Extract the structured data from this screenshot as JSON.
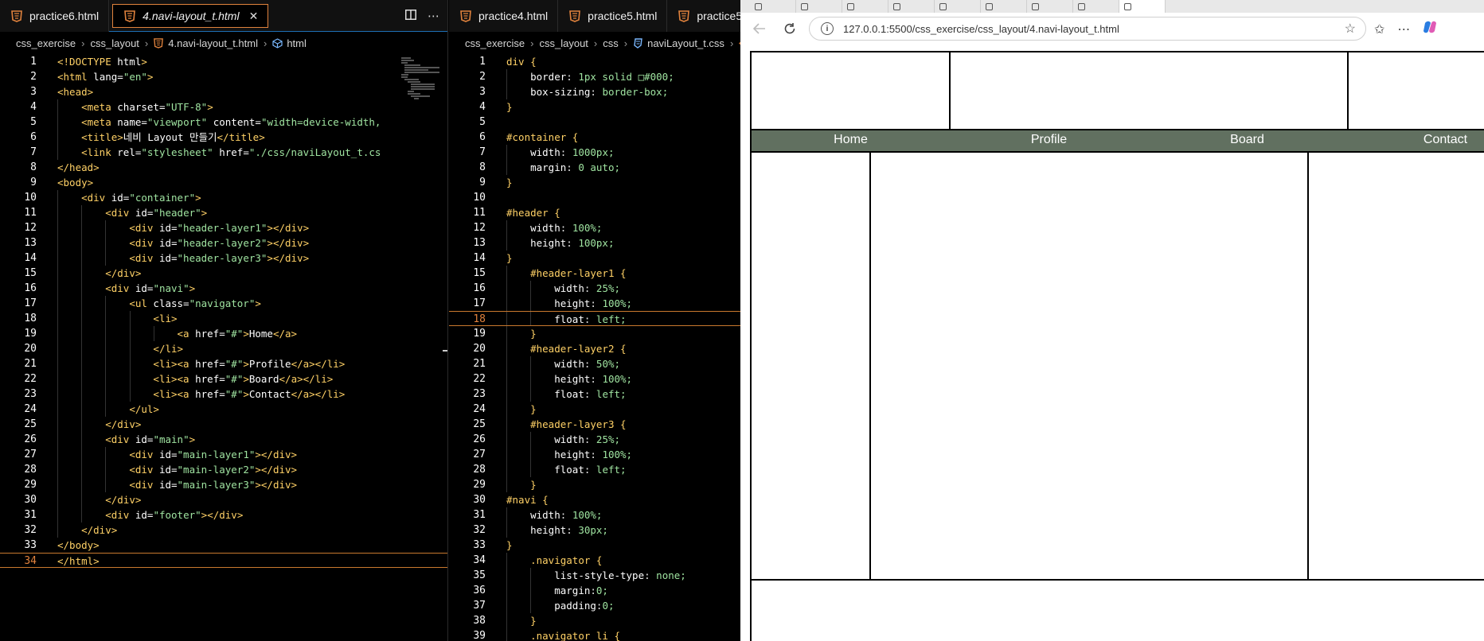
{
  "editor_left": {
    "tabs": [
      {
        "label": "practice6.html",
        "active": false
      },
      {
        "label": "4.navi-layout_t.html",
        "active": true
      }
    ],
    "breadcrumb": [
      "css_exercise",
      "css_layout",
      "4.navi-layout_t.html",
      "html"
    ]
  },
  "editor_right": {
    "tabs": [
      {
        "label": "practice4.html"
      },
      {
        "label": "practice5.html"
      },
      {
        "label": "practice5"
      }
    ],
    "breadcrumb": [
      "css_exercise",
      "css_layout",
      "css",
      "naviLayout_t.css",
      "#"
    ]
  },
  "html_lines": [
    "<!DOCTYPE html>",
    "<html lang=\"en\">",
    "<head>",
    "    <meta charset=\"UTF-8\">",
    "    <meta name=\"viewport\" content=\"width=device-width,",
    "    <title>네비 Layout 만들기</title>",
    "    <link rel=\"stylesheet\" href=\"./css/naviLayout_t.cs",
    "</head>",
    "<body>",
    "    <div id=\"container\">",
    "        <div id=\"header\">",
    "            <div id=\"header-layer1\"></div>",
    "            <div id=\"header-layer2\"></div>",
    "            <div id=\"header-layer3\"></div>",
    "        </div>",
    "        <div id=\"navi\">",
    "            <ul class=\"navigator\">",
    "                <li>",
    "                    <a href=\"#\">Home</a>",
    "                </li>",
    "                <li><a href=\"#\">Profile</a></li>",
    "                <li><a href=\"#\">Board</a></li>",
    "                <li><a href=\"#\">Contact</a></li>",
    "            </ul>",
    "        </div>",
    "        <div id=\"main\">",
    "            <div id=\"main-layer1\"></div>",
    "            <div id=\"main-layer2\"></div>",
    "            <div id=\"main-layer3\"></div>",
    "        </div>",
    "        <div id=\"footer\"></div>",
    "    </div>",
    "</body>",
    "</html>"
  ],
  "html_current_line": 34,
  "css_lines": [
    "div {",
    "    border: 1px solid □#000;",
    "    box-sizing: border-box;",
    "}",
    "",
    "#container {",
    "    width: 1000px;",
    "    margin: 0 auto;",
    "}",
    "",
    "#header {",
    "    width: 100%;",
    "    height: 100px;",
    "}",
    "    #header-layer1 {",
    "        width: 25%;",
    "        height: 100%;",
    "        float: left;",
    "    }",
    "    #header-layer2 {",
    "        width: 50%;",
    "        height: 100%;",
    "        float: left;",
    "    }",
    "    #header-layer3 {",
    "        width: 25%;",
    "        height: 100%;",
    "        float: left;",
    "    }",
    "#navi {",
    "    width: 100%;",
    "    height: 30px;",
    "}",
    "    .navigator {",
    "        list-style-type: none;",
    "        margin:0;",
    "        padding:0;",
    "    }",
    "    .navigator li {"
  ],
  "css_current_line": 18,
  "browser": {
    "url": "127.0.0.1:5500/css_exercise/css_layout/4.navi-layout_t.html",
    "nav_links": [
      "Home",
      "Profile",
      "Board",
      "Contact"
    ],
    "navi_color": "#617060"
  }
}
